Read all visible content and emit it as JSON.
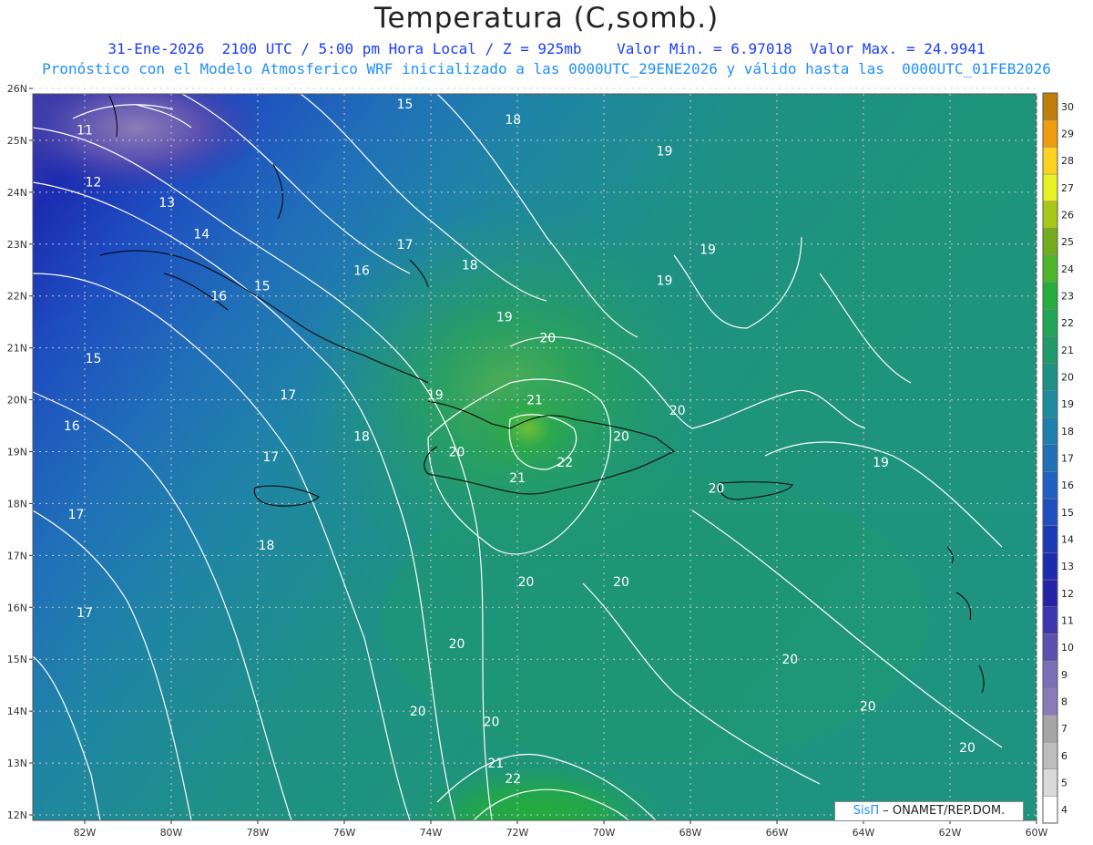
{
  "header": {
    "title": "Temperatura (C,somb.)",
    "subtitle_1": "31-Ene-2026  2100 UTC / 5:00 pm Hora Local / Z = 925mb    Valor Min. = 6.97018  Valor Max. = 24.9941",
    "subtitle_2": "Pronóstico con el Modelo Atmosferico WRF inicializado a las 0000UTC_29ENE2026 y válido hasta las  0000UTC_01FEB2026"
  },
  "credit": {
    "brand": "SisΠ",
    "org": "– ONAMET/REP.DOM."
  },
  "map": {
    "lat_range": [
      12,
      26
    ],
    "lon_range": [
      -83.2,
      -60
    ],
    "lat_labels": [
      "26N",
      "25N",
      "24N",
      "23N",
      "22N",
      "21N",
      "20N",
      "19N",
      "18N",
      "17N",
      "16N",
      "15N",
      "14N",
      "13N",
      "12N"
    ],
    "lon_labels": [
      "82W",
      "80W",
      "78W",
      "76W",
      "74W",
      "72W",
      "70W",
      "68W",
      "66W",
      "64W",
      "62W",
      "60W"
    ],
    "contour_labels": [
      {
        "text": "11",
        "lat": 25.2,
        "lon": -82.0
      },
      {
        "text": "12",
        "lat": 24.2,
        "lon": -81.8
      },
      {
        "text": "13",
        "lat": 23.8,
        "lon": -80.1
      },
      {
        "text": "14",
        "lat": 23.2,
        "lon": -79.3
      },
      {
        "text": "15",
        "lat": 25.7,
        "lon": -74.6
      },
      {
        "text": "15",
        "lat": 22.2,
        "lon": -77.9
      },
      {
        "text": "15",
        "lat": 20.8,
        "lon": -81.8
      },
      {
        "text": "16",
        "lat": 22.0,
        "lon": -78.9
      },
      {
        "text": "16",
        "lat": 22.5,
        "lon": -75.6
      },
      {
        "text": "16",
        "lat": 19.5,
        "lon": -82.3
      },
      {
        "text": "17",
        "lat": 23.0,
        "lon": -74.6
      },
      {
        "text": "17",
        "lat": 20.1,
        "lon": -77.3
      },
      {
        "text": "17",
        "lat": 18.9,
        "lon": -77.7
      },
      {
        "text": "17",
        "lat": 17.8,
        "lon": -82.2
      },
      {
        "text": "17",
        "lat": 15.9,
        "lon": -82.0
      },
      {
        "text": "18",
        "lat": 25.4,
        "lon": -72.1
      },
      {
        "text": "18",
        "lat": 22.6,
        "lon": -73.1
      },
      {
        "text": "18",
        "lat": 19.3,
        "lon": -75.6
      },
      {
        "text": "18",
        "lat": 17.2,
        "lon": -77.8
      },
      {
        "text": "19",
        "lat": 24.8,
        "lon": -68.6
      },
      {
        "text": "19",
        "lat": 22.9,
        "lon": -67.6
      },
      {
        "text": "19",
        "lat": 22.3,
        "lon": -68.6
      },
      {
        "text": "19",
        "lat": 21.6,
        "lon": -72.3
      },
      {
        "text": "19",
        "lat": 20.1,
        "lon": -73.9
      },
      {
        "text": "19",
        "lat": 18.8,
        "lon": -63.6
      },
      {
        "text": "20",
        "lat": 21.2,
        "lon": -71.3
      },
      {
        "text": "20",
        "lat": 19.8,
        "lon": -68.3
      },
      {
        "text": "20",
        "lat": 19.3,
        "lon": -69.6
      },
      {
        "text": "20",
        "lat": 19.0,
        "lon": -73.4
      },
      {
        "text": "20",
        "lat": 18.3,
        "lon": -67.4
      },
      {
        "text": "20",
        "lat": 16.5,
        "lon": -71.8
      },
      {
        "text": "20",
        "lat": 16.5,
        "lon": -69.6
      },
      {
        "text": "20",
        "lat": 15.3,
        "lon": -73.4
      },
      {
        "text": "20",
        "lat": 15.0,
        "lon": -65.7
      },
      {
        "text": "20",
        "lat": 14.1,
        "lon": -63.9
      },
      {
        "text": "20",
        "lat": 14.0,
        "lon": -74.3
      },
      {
        "text": "20",
        "lat": 13.8,
        "lon": -72.6
      },
      {
        "text": "20",
        "lat": 13.3,
        "lon": -61.6
      },
      {
        "text": "21",
        "lat": 20.0,
        "lon": -71.6
      },
      {
        "text": "21",
        "lat": 18.5,
        "lon": -72.0
      },
      {
        "text": "21",
        "lat": 13.0,
        "lon": -72.5
      },
      {
        "text": "22",
        "lat": 18.8,
        "lon": -70.9
      },
      {
        "text": "22",
        "lat": 12.7,
        "lon": -72.1
      }
    ]
  },
  "legend": {
    "levels": [
      "4",
      "5",
      "6",
      "7",
      "8",
      "9",
      "10",
      "11",
      "12",
      "13",
      "14",
      "15",
      "16",
      "17",
      "18",
      "19",
      "20",
      "21",
      "22",
      "23",
      "24",
      "25",
      "26",
      "27",
      "28",
      "29",
      "30"
    ],
    "colors": [
      "#ffffff",
      "#d9d9d9",
      "#bdbdbd",
      "#a6a6a6",
      "#8b7ab8",
      "#7a6fb8",
      "#5a50b0",
      "#3b36ad",
      "#2323a8",
      "#1c2cb0",
      "#1c3ab8",
      "#1e4ec0",
      "#2060c0",
      "#2070b8",
      "#1f7fae",
      "#1e8a9e",
      "#1e9084",
      "#1f9a6a",
      "#21a453",
      "#26ad3d",
      "#4cb52c",
      "#73ad1d",
      "#a8c718",
      "#e7f324",
      "#ffd21f",
      "#ef9c0e",
      "#c07e0a"
    ]
  }
}
